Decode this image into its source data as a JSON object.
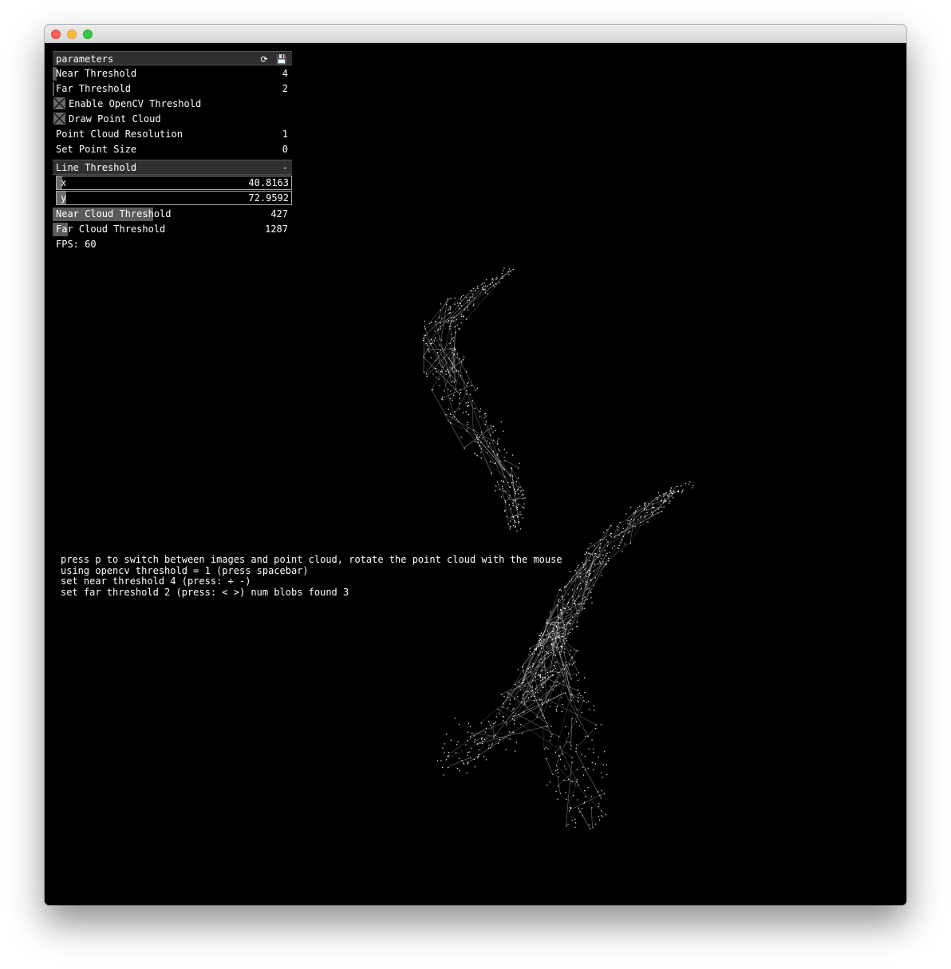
{
  "gui": {
    "title": "parameters",
    "header_icons": "⟳ 💾",
    "near_threshold": {
      "label": "Near Threshold",
      "value": "4",
      "fill": 0.015
    },
    "far_threshold": {
      "label": "Far Threshold",
      "value": "2",
      "fill": 0.008
    },
    "enable_opencv": {
      "label": "Enable OpenCV Threshold",
      "checked": true
    },
    "draw_point_cloud": {
      "label": "Draw Point Cloud",
      "checked": true
    },
    "point_cloud_resolution": {
      "label": "Point Cloud Resolution",
      "value": "1"
    },
    "set_point_size": {
      "label": "Set Point Size",
      "value": "0"
    },
    "line_threshold": {
      "label": "Line Threshold",
      "toggle": "-",
      "x": {
        "label": "x",
        "value": "40.8163",
        "fill": 0.025
      },
      "y": {
        "label": "y",
        "value": "72.9592",
        "fill": 0.04
      }
    },
    "near_cloud_threshold": {
      "label": "Near Cloud Threshold",
      "value": "427",
      "fill": 0.42
    },
    "far_cloud_threshold": {
      "label": "Far Cloud Threshold",
      "value": "1287",
      "fill": 0.063
    },
    "fps": "FPS: 60"
  },
  "info": [
    "press p to switch between images and point cloud, rotate the point cloud with the mouse",
    "using opencv threshold = 1 (press spacebar)",
    "set near threshold 4 (press: + -)",
    "set far threshold 2 (press: < >) num blobs found 3"
  ]
}
